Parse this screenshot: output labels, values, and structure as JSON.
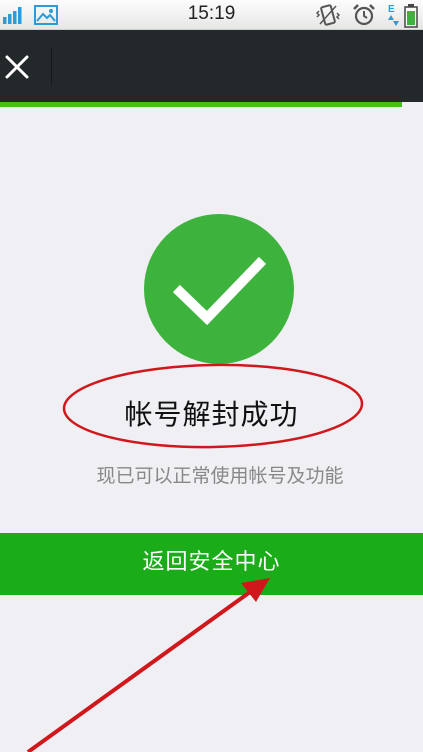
{
  "status_bar": {
    "time": "15:19",
    "icons": [
      "signal-icon",
      "image-icon",
      "vibrate-icon",
      "alarm-icon",
      "data-transfer-icon",
      "battery-icon"
    ]
  },
  "title_bar": {
    "close_icon": "close-icon",
    "background_color": "#23282b"
  },
  "progress": {
    "value": 0.95,
    "color": "#45c01a"
  },
  "result": {
    "icon": "checkmark-icon",
    "icon_color": "#3db33d",
    "title": "帐号解封成功",
    "description": "现已可以正常使用帐号及功能"
  },
  "actions": {
    "return_label": "返回安全中心",
    "button_color": "#1aad19"
  },
  "annotations": {
    "highlight_color": "#d0181c"
  }
}
